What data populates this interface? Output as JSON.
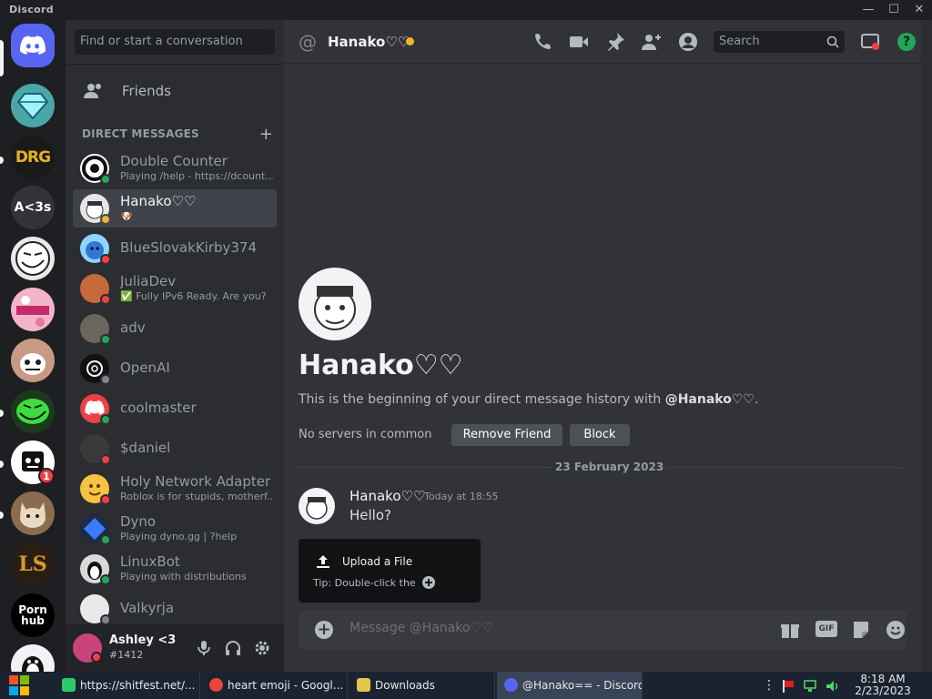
{
  "window": {
    "app_name": "Discord"
  },
  "servers": [
    {
      "name": "Home",
      "label": ""
    },
    {
      "name": "Diamond",
      "label": ""
    },
    {
      "name": "DRG",
      "label": "DRG"
    },
    {
      "name": "A<3s",
      "label": "A<3s"
    },
    {
      "name": "Troll",
      "label": ""
    },
    {
      "name": "Pop",
      "label": ""
    },
    {
      "name": "Sans",
      "label": ""
    },
    {
      "name": "Trollface",
      "label": ""
    },
    {
      "name": "Robot",
      "label": "",
      "badge": "1"
    },
    {
      "name": "Cat",
      "label": ""
    },
    {
      "name": "LS",
      "label": "LS"
    },
    {
      "name": "Porn hub",
      "label": "Porn hub"
    },
    {
      "name": "Penguin",
      "label": ""
    }
  ],
  "dm_column": {
    "search_placeholder": "Find or start a conversation",
    "friends_label": "Friends",
    "section_title": "DIRECT MESSAGES",
    "items": [
      {
        "name": "Double Counter",
        "sub": "Playing /help - https://dcount..."
      },
      {
        "name": "Hanako♡♡",
        "sub": "🐶"
      },
      {
        "name": "BlueSlovakKirby374",
        "sub": ""
      },
      {
        "name": "JuliaDev",
        "sub": "✅ Fully IPv6 Ready. Are you?"
      },
      {
        "name": "adv",
        "sub": ""
      },
      {
        "name": "OpenAI",
        "sub": ""
      },
      {
        "name": "coolmaster",
        "sub": ""
      },
      {
        "name": "$daniel",
        "sub": ""
      },
      {
        "name": "Holy Network Adapter",
        "sub": "Roblox is for stupids, motherf..."
      },
      {
        "name": "Dyno",
        "sub": "Playing dyno.gg | ?help"
      },
      {
        "name": "LinuxBot",
        "sub": "Playing with distributions"
      },
      {
        "name": "Valkyrja",
        "sub": ""
      }
    ]
  },
  "user_panel": {
    "name": "Ashley <3",
    "tag": "#1412"
  },
  "topbar": {
    "channel_name": "Hanako♡♡",
    "search_placeholder": "Search"
  },
  "intro": {
    "name": "Hanako♡♡",
    "text_prefix": "This is the beginning of your direct message history with ",
    "text_mention": "@Hanako♡♡",
    "text_suffix": ".",
    "no_servers": "No servers in common",
    "remove_friend": "Remove Friend",
    "block": "Block"
  },
  "date_divider": "23 February 2023",
  "message": {
    "author": "Hanako♡♡",
    "time": "Today at 18:55",
    "text": "Hello?"
  },
  "upload_popup": {
    "title": "Upload a File",
    "tip": "Tip: Double-click the"
  },
  "composer": {
    "placeholder": "Message @Hanako♡♡",
    "gif": "GIF"
  },
  "taskbar": {
    "tasks": [
      {
        "label": "https://shitfest.net/..."
      },
      {
        "label": "heart emoji - Googl..."
      },
      {
        "label": "Downloads"
      },
      {
        "label": "@Hanako== - Discord"
      }
    ],
    "time": "8:18 AM",
    "date": "2/23/2023"
  },
  "colors": {
    "blurple": "#5865f2",
    "online": "#23a55a",
    "dnd": "#f23f43",
    "idle": "#f0b232"
  }
}
